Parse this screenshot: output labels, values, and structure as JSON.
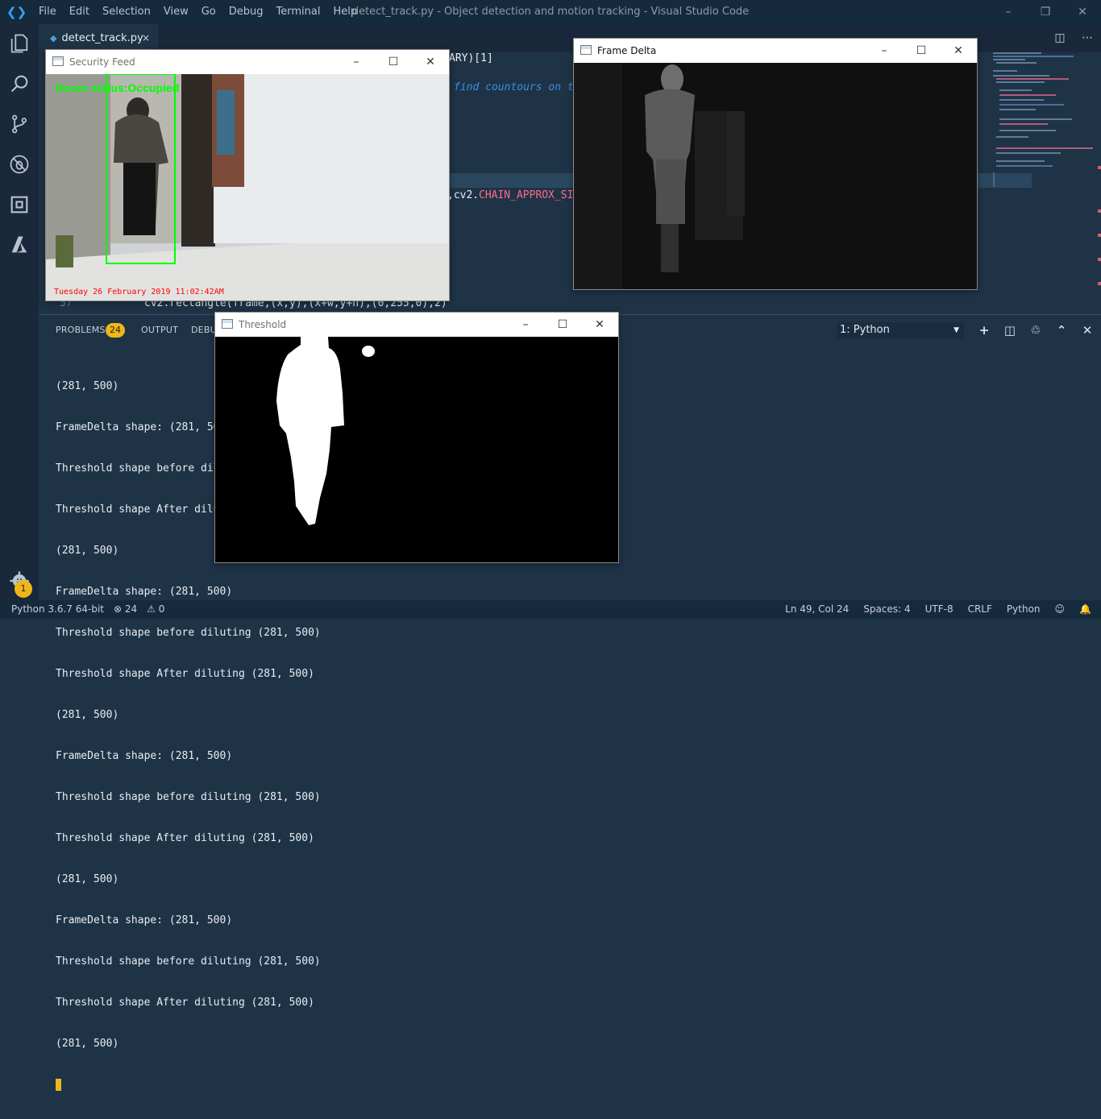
{
  "window": {
    "title": "detect_track.py - Object detection and motion tracking - Visual Studio Code",
    "menu": [
      "File",
      "Edit",
      "Selection",
      "View",
      "Go",
      "Debug",
      "Terminal",
      "Help"
    ],
    "minimize_glyph": "–",
    "maximize_glyph": "❐",
    "close_glyph": "✕"
  },
  "activity_bar": {
    "items": [
      "explorer-icon",
      "search-icon",
      "source-control-icon",
      "debug-icon",
      "extensions-icon",
      "azure-icon"
    ],
    "manage_badge": "1"
  },
  "tabs": [
    {
      "label": "detect_track.py",
      "active": true,
      "close": "×"
    }
  ],
  "editor": {
    "visible_fragments": [
      {
        "text": "ARY)[1]",
        "color": "#e7edf2"
      },
      {
        "text": "find countours on t",
        "color": "#3b8ee6",
        "italic": true
      },
      {
        "text": ",cv2.",
        "color": "#e7edf2"
      },
      {
        "text": "CHAIN_APPROX_SI",
        "color": "#ff6b8b"
      }
    ],
    "line_57_number": "57",
    "line_57_code": "cv2.rectangle(frame,(x,y),(x+w,y+h),(0,255,0),2)"
  },
  "panel": {
    "tabs": {
      "problems": "PROBLEMS",
      "problems_count": "24",
      "output": "OUTPUT",
      "debug": "DEBUG CONSOLE"
    },
    "terminal_selector": "1: Python",
    "terminal_lines": [
      "(281, 500)",
      "FrameDelta shape: (281, 500)",
      "Threshold shape before diluting (281, 500)",
      "Threshold shape After diluting (281, 500)",
      "(281, 500)",
      "FrameDelta shape: (281, 500)",
      "Threshold shape before diluting (281, 500)",
      "Threshold shape After diluting (281, 500)",
      "(281, 500)",
      "FrameDelta shape: (281, 500)",
      "Threshold shape before diluting (281, 500)",
      "Threshold shape After diluting (281, 500)",
      "(281, 500)",
      "FrameDelta shape: (281, 500)",
      "Threshold shape before diluting (281, 500)",
      "Threshold shape After diluting (281, 500)",
      "(281, 500)"
    ]
  },
  "status_bar": {
    "python": "Python 3.6.7 64-bit",
    "errors": "⊗ 24",
    "warnings": "⚠ 0",
    "position": "Ln 49, Col 24",
    "spaces": "Spaces: 4",
    "encoding": "UTF-8",
    "eol": "CRLF",
    "language": "Python"
  },
  "cv_windows": {
    "security": {
      "title": "Security Feed",
      "overlay_status": "Room status:Occupied",
      "timestamp": "Tuesday 26 February 2019 11:02:42AM"
    },
    "delta": {
      "title": "Frame Delta"
    },
    "threshold": {
      "title": "Threshold"
    }
  },
  "colors": {
    "accent": "#f0b619",
    "editor_bg": "#1f3347",
    "chrome_bg": "#162a3d"
  }
}
